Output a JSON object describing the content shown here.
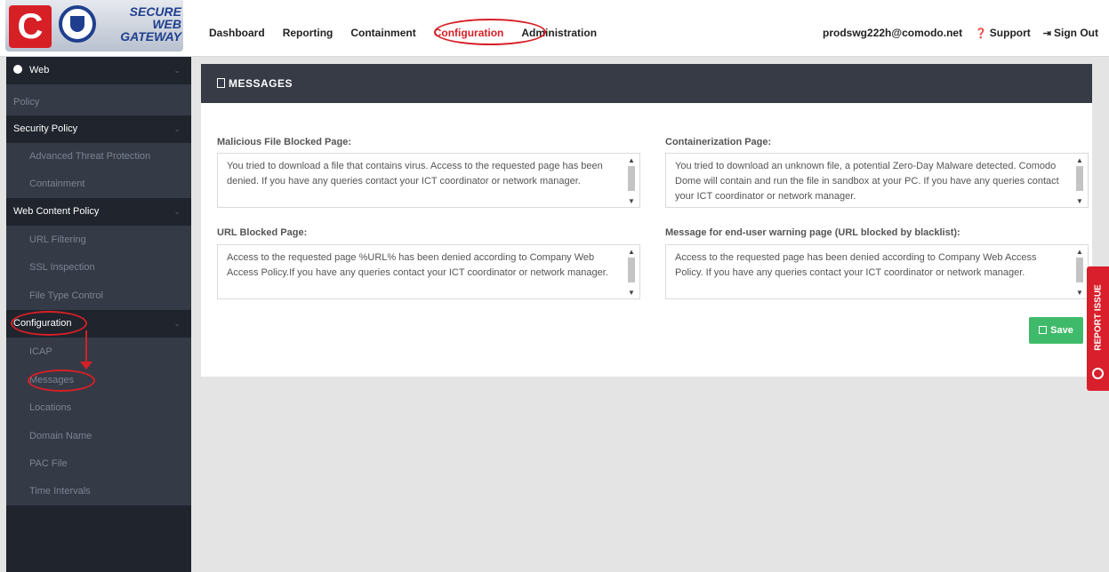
{
  "brand": {
    "line1": "SECURE WEB",
    "line2": "GATEWAY",
    "c": "C"
  },
  "nav": {
    "items": [
      {
        "label": "Dashboard"
      },
      {
        "label": "Reporting"
      },
      {
        "label": "Containment"
      },
      {
        "label": "Configuration"
      },
      {
        "label": "Administration"
      }
    ],
    "active": "Configuration"
  },
  "user": {
    "email": "prodswg222h@comodo.net",
    "support": "Support",
    "signout": "Sign Out"
  },
  "sidebar": {
    "web": "Web",
    "policy": "Policy",
    "security_policy": "Security Policy",
    "atp": "Advanced Threat Protection",
    "containment": "Containment",
    "web_content_policy": "Web Content Policy",
    "url_filtering": "URL Filtering",
    "ssl_inspection": "SSL Inspection",
    "file_type_control": "File Type Control",
    "configuration": "Configuration",
    "icap": "ICAP",
    "messages": "Messages",
    "locations": "Locations",
    "domain_name": "Domain Name",
    "pac_file": "PAC File",
    "time_intervals": "Time Intervals"
  },
  "panel": {
    "title": "MESSAGES",
    "fields": {
      "malicious": {
        "label": "Malicious File Blocked Page:",
        "value": "You tried to download a file that contains virus. Access to the requested page has been denied. If you have any queries contact your ICT coordinator or network manager."
      },
      "containerization": {
        "label": "Containerization Page:",
        "value": "You tried to download an unknown file, a potential Zero-Day Malware detected. Comodo Dome will contain and run the file in sandbox at your PC. If you have any queries contact your ICT coordinator or network manager."
      },
      "url_blocked": {
        "label": "URL Blocked Page:",
        "value": "Access to the requested page %URL% has been denied according to Company Web Access Policy.If you have any queries contact your ICT coordinator or network manager."
      },
      "warning": {
        "label": "Message for end-user warning page (URL blocked by blacklist):",
        "value": "Access to the requested page has been denied according to Company Web Access Policy. If you have any queries contact your ICT coordinator or network manager."
      }
    },
    "save": "Save"
  },
  "report_issue": "REPORT ISSUE",
  "colors": {
    "accent_red": "#d71f26",
    "sidebar": "#343a46",
    "save_green": "#3fba6a"
  }
}
